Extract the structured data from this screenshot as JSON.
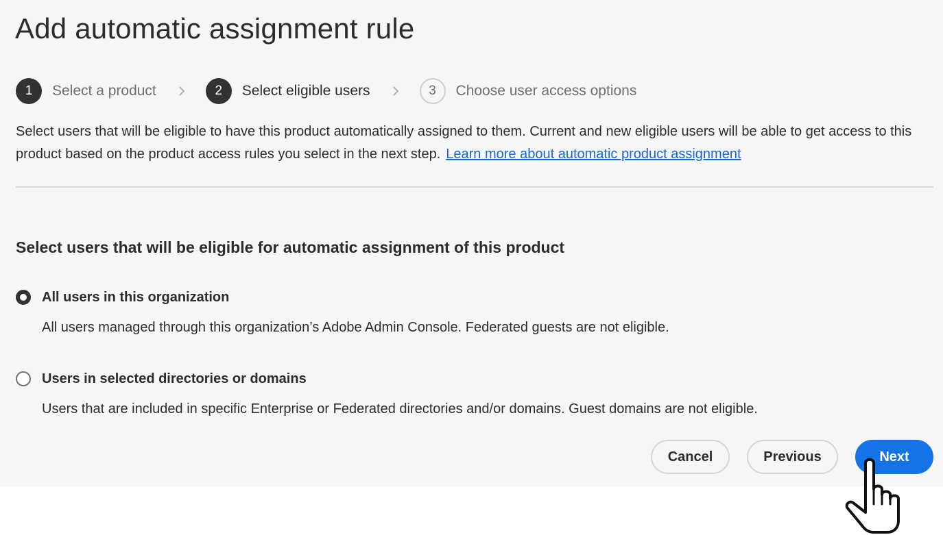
{
  "title": "Add automatic assignment rule",
  "steps": [
    {
      "number": "1",
      "label": "Select a product",
      "state": "done"
    },
    {
      "number": "2",
      "label": "Select eligible users",
      "state": "current"
    },
    {
      "number": "3",
      "label": "Choose user access options",
      "state": "todo"
    }
  ],
  "intro": {
    "text": "Select users that will be eligible to have this product automatically assigned to them. Current and new eligible users will be able to get access to this product based on the product access rules you select in the next step.",
    "link_text": "Learn more about automatic product assignment"
  },
  "section_heading": "Select users that will be eligible for automatic assignment of this product",
  "options": [
    {
      "label": "All users in this organization",
      "description": "All users managed through this organization’s Adobe Admin Console. Federated guests are not eligible.",
      "selected": true
    },
    {
      "label": "Users in selected directories or domains",
      "description": "Users that are included in specific Enterprise or Federated directories and/or domains. Guest domains are not eligible.",
      "selected": false
    }
  ],
  "buttons": {
    "cancel": "Cancel",
    "previous": "Previous",
    "next": "Next"
  },
  "colors": {
    "accent": "#1473e6",
    "link": "#1a66cc",
    "background": "#f6f6f6"
  },
  "icons": {
    "step_separator": "chevron-right-icon",
    "cursor": "hand-pointer-icon"
  }
}
